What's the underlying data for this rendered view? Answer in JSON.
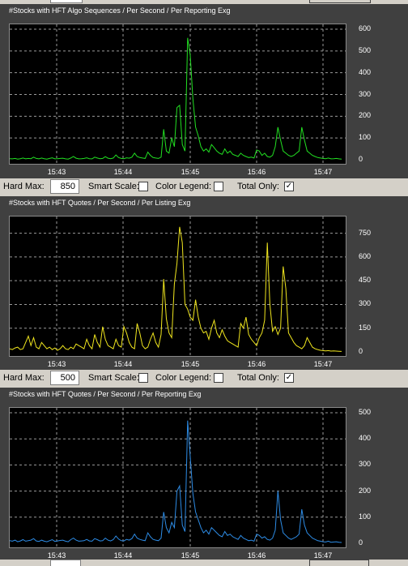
{
  "panels": [
    {
      "title": "#Stocks with HFT Algo Sequences / Per Second / Per Reporting Exg",
      "color": "#22e022",
      "chart_data": {
        "type": "line",
        "title": "#Stocks with HFT Algo Sequences / Per Second / Per Reporting Exg",
        "xlabel": "",
        "ylabel": "",
        "ylim": [
          0,
          600
        ],
        "yticks": [
          "600",
          "500",
          "400",
          "300",
          "200",
          "100",
          "0"
        ],
        "xticks": [
          "15:43",
          "15:44",
          "15:45",
          "15:46",
          "15:47"
        ],
        "grid": true,
        "series": [
          {
            "values": [
              5,
              4,
              6,
              3,
              5,
              8,
              4,
              6,
              5,
              12,
              6,
              4,
              8,
              5,
              3,
              6,
              9,
              4,
              5,
              6,
              7,
              4,
              3,
              8,
              15,
              7,
              4,
              5,
              6,
              9,
              5,
              4,
              12,
              8,
              5,
              6,
              14,
              7,
              5,
              8,
              22,
              10,
              6,
              5,
              9,
              7,
              12,
              30,
              15,
              10,
              8,
              6,
              35,
              20,
              10,
              8,
              6,
              12,
              140,
              40,
              30,
              100,
              60,
              240,
              250,
              70,
              40,
              560,
              480,
              280,
              150,
              110,
              60,
              40,
              50,
              35,
              70,
              55,
              40,
              30,
              25,
              50,
              30,
              40,
              25,
              20,
              15,
              30,
              20,
              15,
              10,
              12,
              8,
              45,
              40,
              20,
              30,
              15,
              12,
              20,
              60,
              150,
              90,
              40,
              30,
              20,
              15,
              20,
              30,
              40,
              150,
              90,
              40,
              30,
              20,
              15,
              10,
              8,
              6,
              5,
              8,
              4,
              5,
              6,
              4,
              3
            ]
          }
        ]
      },
      "yticks": [
        "600",
        "500",
        "400",
        "300",
        "200",
        "100",
        "0"
      ],
      "xticks": [
        "15:43",
        "15:44",
        "15:45",
        "15:46",
        "15:47"
      ]
    },
    {
      "title": "#Stocks with HFT Quotes / Per Second / Per Listing Exg",
      "color": "#f0e61e",
      "chart_data": {
        "type": "line",
        "title": "#Stocks with HFT Quotes / Per Second / Per Listing Exg",
        "xlabel": "",
        "ylabel": "",
        "ylim": [
          0,
          825
        ],
        "yticks": [
          "750",
          "600",
          "450",
          "300",
          "150",
          "0"
        ],
        "xticks": [
          "15:43",
          "15:44",
          "15:45",
          "15:46",
          "15:47"
        ],
        "grid": true,
        "series": [
          {
            "values": [
              20,
              15,
              25,
              30,
              15,
              20,
              60,
              100,
              40,
              90,
              30,
              20,
              60,
              40,
              20,
              30,
              15,
              25,
              10,
              20,
              40,
              20,
              15,
              30,
              20,
              50,
              40,
              30,
              20,
              80,
              40,
              20,
              110,
              60,
              30,
              160,
              80,
              40,
              30,
              20,
              80,
              40,
              30,
              160,
              120,
              60,
              30,
              20,
              180,
              120,
              40,
              20,
              30,
              80,
              120,
              60,
              30,
              110,
              460,
              210,
              120,
              90,
              430,
              560,
              790,
              690,
              300,
              270,
              220,
              200,
              330,
              220,
              150,
              120,
              130,
              80,
              150,
              200,
              120,
              90,
              140,
              100,
              70,
              60,
              50,
              40,
              30,
              180,
              150,
              220,
              110,
              80,
              60,
              40,
              90,
              120,
              200,
              690,
              300,
              130,
              160,
              110,
              150,
              540,
              400,
              120,
              90,
              60,
              40,
              30,
              20,
              40,
              90,
              60,
              30,
              20,
              15,
              10,
              8,
              6,
              8,
              5,
              6,
              5,
              4,
              3
            ]
          }
        ]
      },
      "yticks": [
        "750",
        "600",
        "450",
        "300",
        "150",
        "0"
      ],
      "xticks": [
        "15:43",
        "15:44",
        "15:45",
        "15:46",
        "15:47"
      ]
    },
    {
      "title": "#Stocks with HFT Quotes / Per Second / Per Reporting Exg",
      "color": "#2d8ce6",
      "chart_data": {
        "type": "line",
        "title": "#Stocks with HFT Quotes / Per Second / Per Reporting Exg",
        "xlabel": "",
        "ylabel": "",
        "ylim": [
          0,
          500
        ],
        "yticks": [
          "500",
          "400",
          "300",
          "200",
          "100",
          "0"
        ],
        "xticks": [
          "15:43",
          "15:44",
          "15:45",
          "15:46",
          "15:47"
        ],
        "grid": true,
        "series": [
          {
            "values": [
              10,
              8,
              12,
              6,
              9,
              14,
              8,
              10,
              12,
              18,
              9,
              7,
              12,
              8,
              6,
              10,
              14,
              7,
              9,
              11,
              12,
              8,
              6,
              14,
              20,
              12,
              8,
              9,
              10,
              15,
              9,
              8,
              18,
              14,
              9,
              10,
              20,
              12,
              9,
              14,
              28,
              16,
              10,
              9,
              15,
              12,
              18,
              35,
              20,
              15,
              12,
              10,
              40,
              25,
              15,
              12,
              10,
              20,
              120,
              60,
              40,
              80,
              60,
              200,
              220,
              70,
              45,
              470,
              330,
              190,
              120,
              90,
              60,
              40,
              50,
              35,
              60,
              50,
              40,
              30,
              25,
              45,
              30,
              35,
              25,
              20,
              15,
              30,
              20,
              15,
              10,
              12,
              8,
              35,
              30,
              20,
              25,
              15,
              12,
              20,
              50,
              200,
              90,
              40,
              30,
              20,
              15,
              20,
              25,
              35,
              130,
              70,
              40,
              30,
              20,
              15,
              10,
              8,
              6,
              5,
              8,
              4,
              5,
              6,
              4,
              3
            ]
          }
        ]
      },
      "yticks": [
        "500",
        "400",
        "300",
        "200",
        "100",
        "0"
      ],
      "xticks": [
        "15:43",
        "15:44",
        "15:45",
        "15:46",
        "15:47"
      ]
    }
  ],
  "controls": [
    {
      "hard_max_label": "Hard Max:",
      "hard_max_value": "850",
      "smart_scale_label": "Smart Scale:",
      "smart_scale_checked": "",
      "color_legend_label": "Color Legend:",
      "color_legend_checked": "",
      "total_only_label": "Total Only:",
      "total_only_checked": "✓"
    },
    {
      "hard_max_label": "Hard Max:",
      "hard_max_value": "500",
      "smart_scale_label": "Smart Scale:",
      "smart_scale_checked": "",
      "color_legend_label": "Color Legend:",
      "color_legend_checked": "",
      "total_only_label": "Total Only:",
      "total_only_checked": "✓"
    }
  ]
}
